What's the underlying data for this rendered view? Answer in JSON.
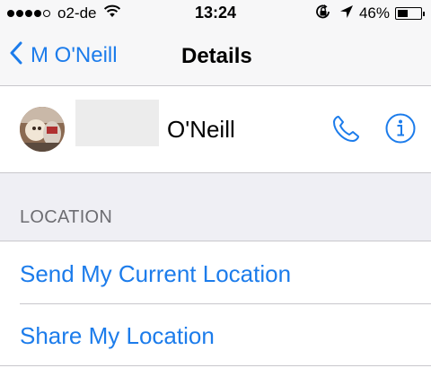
{
  "status_bar": {
    "signal_dots": 5,
    "signal_filled": 4,
    "carrier": "o2-de",
    "time": "13:24",
    "battery_percent_label": "46%",
    "battery_level": 0.46,
    "icons": [
      "wifi-icon",
      "rotation-lock-icon",
      "location-arrow-icon",
      "battery-icon"
    ]
  },
  "nav": {
    "back_label": "M O'Neill",
    "title": "Details"
  },
  "contact": {
    "name": "O'Neill",
    "actions": [
      "phone-icon",
      "info-icon"
    ]
  },
  "location": {
    "header": "LOCATION",
    "items": [
      {
        "label": "Send My Current Location"
      },
      {
        "label": "Share My Location"
      }
    ]
  },
  "colors": {
    "accent": "#1c7ceb",
    "bar_bg": "#f7f7f8",
    "section_bg": "#efeff4",
    "separator": "#c8c7cc",
    "section_text": "#6d6d72"
  }
}
